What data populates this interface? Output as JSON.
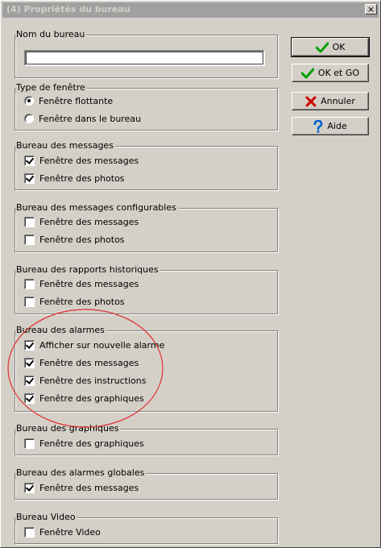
{
  "window": {
    "title": "(4)  Propriétés du bureau",
    "close_glyph": "×"
  },
  "buttons": {
    "ok": {
      "label": "OK",
      "icon": "checkmark-icon",
      "color": "#00a000"
    },
    "ok_go": {
      "label": "OK et GO",
      "icon": "checkmark-icon",
      "color": "#00a000"
    },
    "cancel": {
      "label": "Annuler",
      "icon": "cross-icon",
      "color": "#d00000"
    },
    "help": {
      "label": "Aide",
      "icon": "question-icon",
      "color": "#0060d0"
    }
  },
  "name_group": {
    "title": "Nom du bureau",
    "value": ""
  },
  "window_type": {
    "title": "Type de fenêtre",
    "options": [
      {
        "label": "Fenêtre flottante",
        "selected": true
      },
      {
        "label": "Fenêtre dans le bureau",
        "selected": false
      }
    ]
  },
  "groups": [
    {
      "title": "Bureau des messages",
      "items": [
        {
          "label": "Fenêtre des messages",
          "checked": true
        },
        {
          "label": "Fenêtre des photos",
          "checked": true
        }
      ]
    },
    {
      "title": "Bureau des messages configurables",
      "items": [
        {
          "label": "Fenêtre des messages",
          "checked": false
        },
        {
          "label": "Fenêtre des photos",
          "checked": false
        }
      ]
    },
    {
      "title": "Bureau des rapports historiques",
      "items": [
        {
          "label": "Fenêtre des messages",
          "checked": false
        },
        {
          "label": "Fenêtre des photos",
          "checked": false
        }
      ]
    },
    {
      "title": "Bureau des alarmes",
      "items": [
        {
          "label": "Afficher sur nouvelle alarme",
          "checked": true
        },
        {
          "label": "Fenêtre des messages",
          "checked": true
        },
        {
          "label": "Fenêtre des instructions",
          "checked": true
        },
        {
          "label": "Fenêtre des graphiques",
          "checked": true
        }
      ]
    },
    {
      "title": "Bureau des graphiques",
      "items": [
        {
          "label": "Fenêtre des graphiques",
          "checked": false
        }
      ]
    },
    {
      "title": "Bureau des alarmes globales",
      "items": [
        {
          "label": "Fenêtre des messages",
          "checked": true
        }
      ]
    },
    {
      "title": "Bureau Video",
      "items": [
        {
          "label": "Fenêtre Video",
          "checked": false
        }
      ]
    }
  ],
  "annotation": {
    "shape": "ellipse",
    "color": "#e03030"
  }
}
